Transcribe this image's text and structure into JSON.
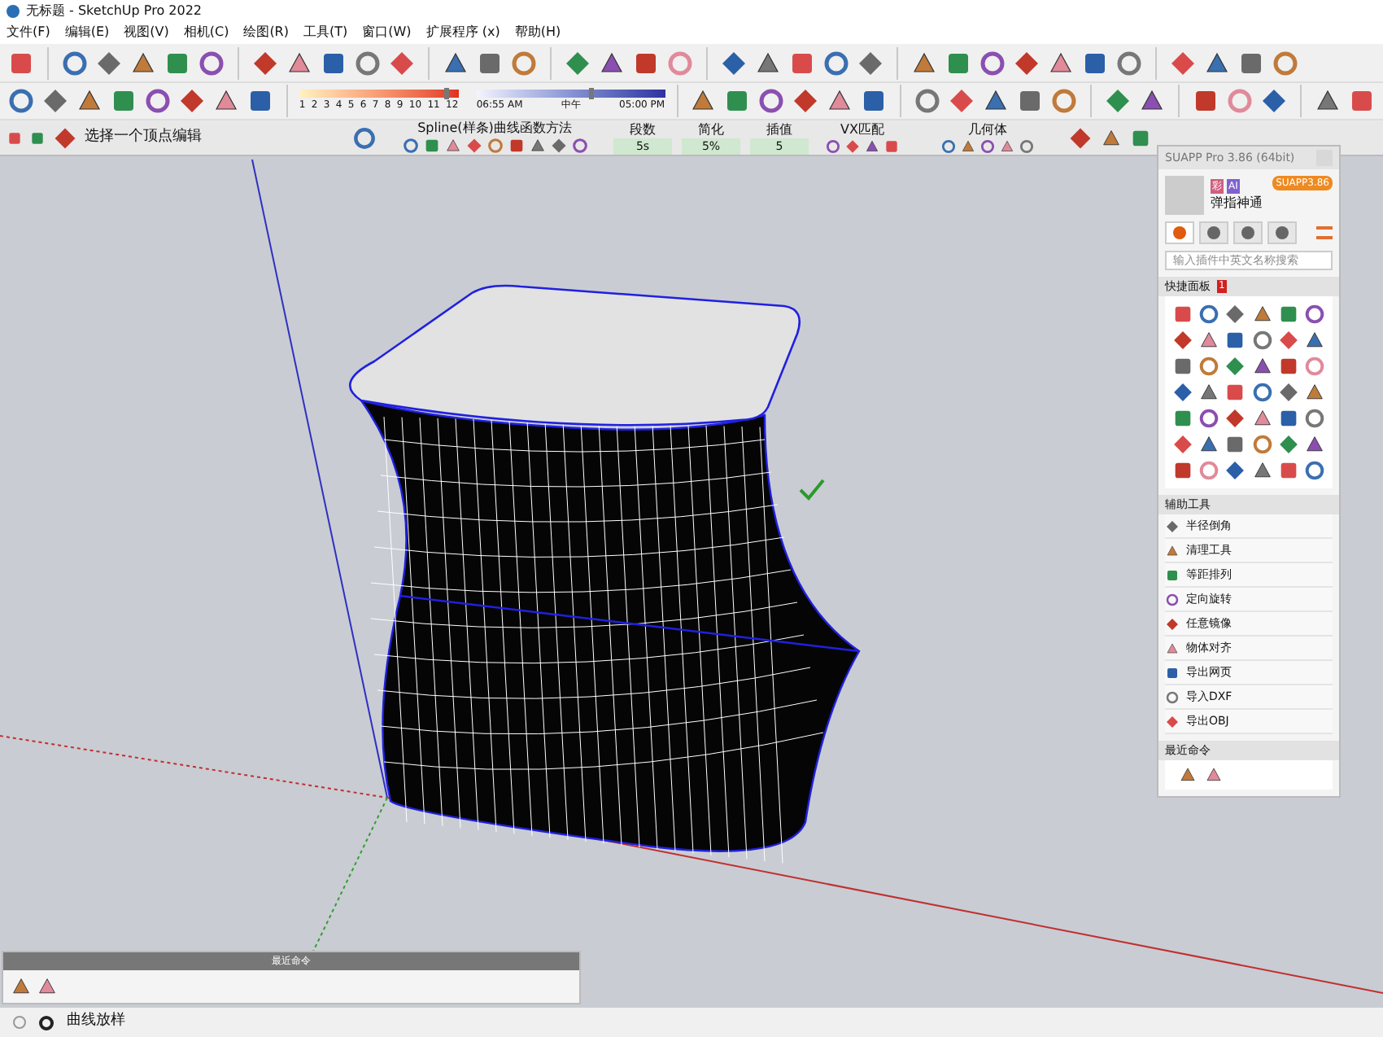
{
  "window": {
    "title": "无标题 - SketchUp Pro 2022"
  },
  "menu": [
    "文件(F)",
    "编辑(E)",
    "视图(V)",
    "相机(C)",
    "绘图(R)",
    "工具(T)",
    "窗口(W)",
    "扩展程序 (x)",
    "帮助(H)"
  ],
  "shadow_bar": {
    "months": [
      "1",
      "2",
      "3",
      "4",
      "5",
      "6",
      "7",
      "8",
      "9",
      "10",
      "11",
      "12"
    ],
    "month_slider": {
      "level": 0.91
    },
    "times": [
      "06:55 AM",
      "中午",
      "05:00 PM"
    ],
    "time_slider": {
      "level": 0.6
    }
  },
  "spline_bar": {
    "prompt": "选择一个顶点编辑",
    "method_title": "Spline(样条)曲线函数方法",
    "fields": [
      {
        "label": "段数",
        "value": "5s"
      },
      {
        "label": "简化",
        "value": "5%"
      },
      {
        "label": "插值",
        "value": "5"
      }
    ],
    "vx_title": "VX匹配",
    "geometry_title": "几何体"
  },
  "suapp": {
    "title": "SUAPP Pro 3.86 (64bit)",
    "badges": [
      "彩",
      "AI"
    ],
    "user": "弹指神通",
    "version_button": "SUAPP3.86",
    "tabs": [
      {
        "selected": true
      },
      {
        "selected": false
      },
      {
        "selected": false
      },
      {
        "selected": false
      }
    ],
    "search": {
      "placeholder": "输入插件中英文名称搜索"
    },
    "quick_panel": {
      "title": "快捷面板",
      "badge": "1"
    },
    "helper_tools": {
      "title": "辅助工具",
      "items": [
        "半径倒角",
        "清理工具",
        "等距排列",
        "定向旋转",
        "任意镜像",
        "物体对齐",
        "导出网页",
        "导入DXF",
        "导出OBJ"
      ]
    },
    "recent": {
      "title": "最近命令"
    }
  },
  "recent_panel": {
    "title": "最近命令"
  },
  "status_bar": {
    "text": "曲线放样"
  }
}
